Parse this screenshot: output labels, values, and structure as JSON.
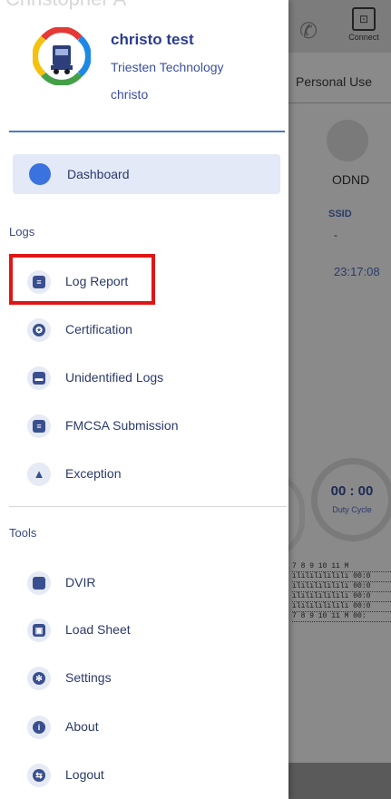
{
  "ghost_title": "Christopher A",
  "background": {
    "connect_label": "Connect",
    "personal_use": "Personal Use",
    "status_code": "ODND",
    "ssid_label": "SSID",
    "ssid_value": "-",
    "time": "23:17:08",
    "duty_value": "00 : 00",
    "duty_label": "Duty Cycle",
    "grid_lines": [
      "7 8 9 10 11 M",
      "ılılılılılılı 00:0",
      "ılılılılılılı 00:0",
      "ılılılılılılı 00:0",
      "ılılılılılılı 00:0",
      "7 8 9 10 11 M 00:"
    ]
  },
  "profile": {
    "name": "christo test",
    "company": "Triesten Technology",
    "username": "christo"
  },
  "menu": {
    "dashboard": "Dashboard",
    "logs_section": "Logs",
    "log_report": "Log Report",
    "certification": "Certification",
    "unidentified_logs": "Unidentified Logs",
    "fmcsa_submission": "FMCSA Submission",
    "exception": "Exception",
    "tools_section": "Tools",
    "dvir": "DVIR",
    "load_sheet": "Load Sheet",
    "settings": "Settings",
    "about": "About",
    "logout": "Logout"
  },
  "colors": {
    "accent": "#2b3d8f",
    "highlight": "#e01515",
    "dashboard_bg": "#e3e9f7"
  }
}
